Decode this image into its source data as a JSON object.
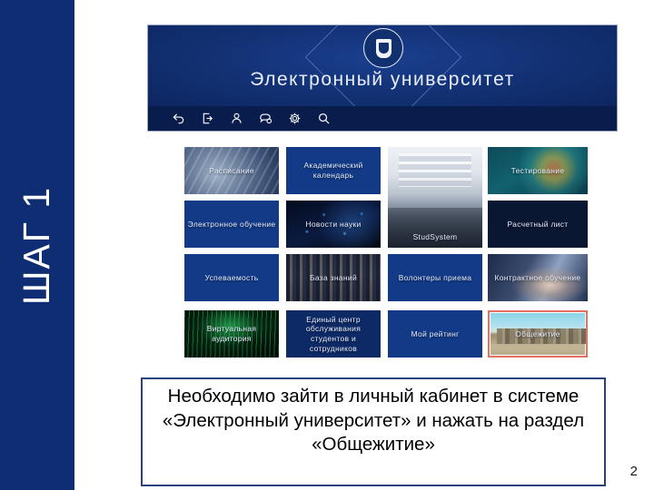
{
  "slide": {
    "step_label": "ШАГ 1",
    "page_number": "2",
    "accent_blue": "#0e2d72",
    "highlight_color": "#e2705f"
  },
  "eu_portal": {
    "title": "Электронный университет",
    "emblem_name": "kazan-federal-university-emblem",
    "toolbar": [
      {
        "name": "back-arrow-icon",
        "label": "Назад"
      },
      {
        "name": "logout-icon",
        "label": "Выход"
      },
      {
        "name": "person-icon",
        "label": "Профиль"
      },
      {
        "name": "chat-icon",
        "label": "Сообщения"
      },
      {
        "name": "gear-icon",
        "label": "Настройки"
      },
      {
        "name": "search-icon",
        "label": "Поиск"
      }
    ],
    "tiles": [
      {
        "label": "Расписание",
        "style": "bg-clock",
        "col": 1,
        "row": 1,
        "highlight": false
      },
      {
        "label": "Академический календарь",
        "style": "bg-plain",
        "col": 2,
        "row": 1,
        "highlight": false
      },
      {
        "label": "StudSystem",
        "style": "bg-atrium",
        "col": 3,
        "row": 1,
        "highlight": false
      },
      {
        "label": "Тестирование",
        "style": "bg-brain",
        "col": 4,
        "row": 1,
        "highlight": false
      },
      {
        "label": "Электронное обучение",
        "style": "bg-plain",
        "col": 1,
        "row": 2,
        "highlight": false
      },
      {
        "label": "Новости науки",
        "style": "bg-news",
        "col": 2,
        "row": 2,
        "highlight": false
      },
      {
        "label": "Расчетный лист",
        "style": "bg-darknavy",
        "col": 4,
        "row": 2,
        "highlight": false
      },
      {
        "label": "Успеваемость",
        "style": "bg-plain",
        "col": 1,
        "row": 3,
        "highlight": false
      },
      {
        "label": "База знаний",
        "style": "bg-library",
        "col": 2,
        "row": 3,
        "highlight": false
      },
      {
        "label": "Волонтеры приема",
        "style": "bg-plain",
        "col": 3,
        "row": 3,
        "highlight": false
      },
      {
        "label": "Контрактное обучение",
        "style": "bg-hands",
        "col": 4,
        "row": 3,
        "highlight": false
      },
      {
        "label": "Виртуальная аудитория",
        "style": "bg-matrix",
        "col": 1,
        "row": 4,
        "highlight": false
      },
      {
        "label": "Единый центр обслуживания студентов и сотрудников",
        "style": "bg-plain-d",
        "col": 2,
        "row": 4,
        "highlight": false
      },
      {
        "label": "Мой рейтинг",
        "style": "bg-plain",
        "col": 3,
        "row": 4,
        "highlight": false
      },
      {
        "label": "Общежитие",
        "style": "bg-dorm",
        "col": 4,
        "row": 4,
        "highlight": true
      }
    ]
  },
  "caption": {
    "text": "Необходимо зайти в личный кабинет в системе «Электронный университет» и нажать на раздел «Общежитие»"
  }
}
